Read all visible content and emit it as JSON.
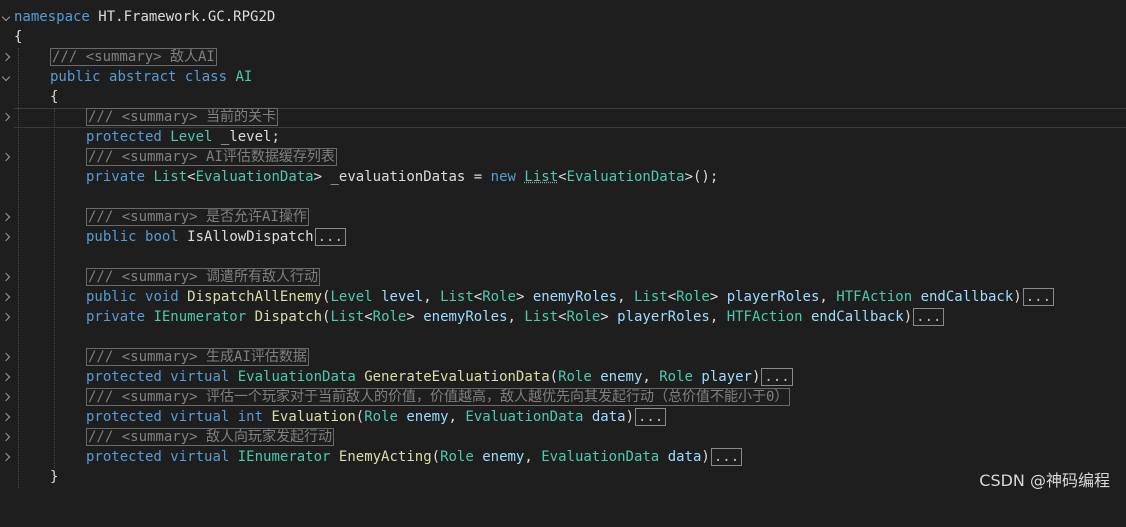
{
  "lines": {
    "l1": {
      "ns_kw": "namespace",
      "ns_name": "HT.Framework.GC.RPG2D"
    },
    "l2": {
      "brace": "{"
    },
    "l3": {
      "doc": "/// <summary> 敌人AI"
    },
    "l4": {
      "kw1": "public",
      "kw2": "abstract",
      "kw3": "class",
      "name": "AI"
    },
    "l5": {
      "brace": "{"
    },
    "l6": {
      "doc": "/// <summary> 当前的关卡"
    },
    "l7": {
      "kw": "protected",
      "type": "Level",
      "name": "_level;"
    },
    "l8": {
      "doc": "/// <summary> AI评估数据缓存列表"
    },
    "l9": {
      "kw": "private",
      "type1": "List",
      "lt": "<",
      "type2": "EvaluationData",
      "gt": ">",
      "name": "_evaluationDatas",
      "eq": "=",
      "new": "new",
      "type3": "List",
      "lt2": "<",
      "type4": "EvaluationData",
      "tail": ">();"
    },
    "l11": {
      "doc": "/// <summary> 是否允许AI操作"
    },
    "l12": {
      "kw1": "public",
      "kw2": "bool",
      "name": "IsAllowDispatch",
      "more": "..."
    },
    "l14": {
      "doc": "/// <summary> 调遣所有敌人行动"
    },
    "l15": {
      "kw1": "public",
      "kw2": "void",
      "fn": "DispatchAllEnemy",
      "p1t": "Level",
      "p1n": "level",
      "p2t": "List",
      "p2a": "Role",
      "p2n": "enemyRoles",
      "p3t": "List",
      "p3a": "Role",
      "p3n": "playerRoles",
      "p4t": "HTFAction",
      "p4n": "endCallback",
      "more": "..."
    },
    "l16": {
      "kw1": "private",
      "type": "IEnumerator",
      "fn": "Dispatch",
      "p1t": "List",
      "p1a": "Role",
      "p1n": "enemyRoles",
      "p2t": "List",
      "p2a": "Role",
      "p2n": "playerRoles",
      "p3t": "HTFAction",
      "p3n": "endCallback",
      "more": "..."
    },
    "l18": {
      "doc": "/// <summary> 生成AI评估数据"
    },
    "l19": {
      "kw1": "protected",
      "kw2": "virtual",
      "type": "EvaluationData",
      "fn": "GenerateEvaluationData",
      "p1t": "Role",
      "p1n": "enemy",
      "p2t": "Role",
      "p2n": "player",
      "more": "..."
    },
    "l20": {
      "doc": "/// <summary> 评估一个玩家对于当前敌人的价值，价值越高，敌人越优先向其发起行动（总价值不能小于0）"
    },
    "l21": {
      "kw1": "protected",
      "kw2": "virtual",
      "kw3": "int",
      "fn": "Evaluation",
      "p1t": "Role",
      "p1n": "enemy",
      "p2t": "EvaluationData",
      "p2n": "data",
      "more": "..."
    },
    "l22": {
      "doc": "/// <summary> 敌人向玩家发起行动"
    },
    "l23": {
      "kw1": "protected",
      "kw2": "virtual",
      "type": "IEnumerator",
      "fn": "EnemyActing",
      "p1t": "Role",
      "p1n": "enemy",
      "p2t": "EvaluationData",
      "p2n": "data",
      "more": "..."
    },
    "l24": {
      "brace": "}"
    }
  },
  "watermark": "CSDN @神码编程",
  "colors": {
    "keyword": "#569cd6",
    "type": "#4ec9b0",
    "function": "#dcdcaa",
    "parameter": "#9cdcfe",
    "doc": "#808080",
    "background": "#1e1e1e"
  }
}
